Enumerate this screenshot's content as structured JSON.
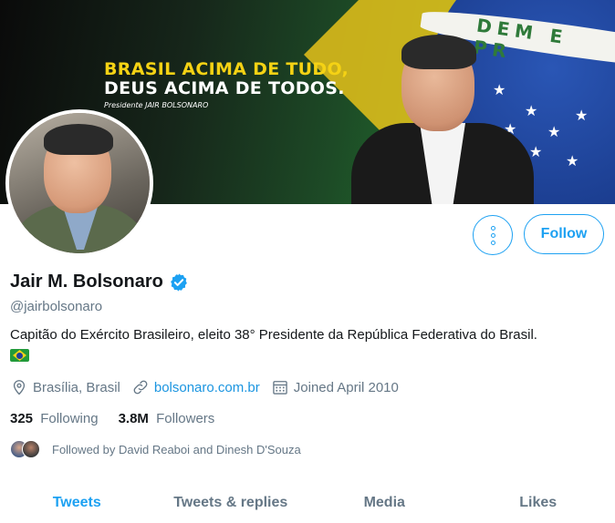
{
  "banner": {
    "slogan_line1": "BRASIL ACIMA DE TUDO,",
    "slogan_line2": "DEUS ACIMA DE TODOS.",
    "slogan_caption": "Presidente JAIR BOLSONARO",
    "flag_motto": "DEM E PR"
  },
  "actions": {
    "more_icon": "more-vertical-icon",
    "follow_label": "Follow",
    "accent_color": "#1da1f2"
  },
  "profile": {
    "name": "Jair M. Bolsonaro",
    "verified_icon": "verified-badge-icon",
    "handle": "@jairbolsonaro",
    "bio": "Capitão do Exército Brasileiro, eleito 38° Presidente da República Federativa do Brasil.",
    "bio_emoji": "brazil-flag-emoji",
    "location": "Brasília, Brasil",
    "website": "bolsonaro.com.br",
    "joined": "Joined April 2010"
  },
  "stats": {
    "following_count": "325",
    "following_label": "Following",
    "followers_count": "3.8M",
    "followers_label": "Followers"
  },
  "followed_by": {
    "text": "Followed by David Reaboi and Dinesh D'Souza"
  },
  "tabs": [
    {
      "label": "Tweets",
      "active": true
    },
    {
      "label": "Tweets & replies",
      "active": false
    },
    {
      "label": "Media",
      "active": false
    },
    {
      "label": "Likes",
      "active": false
    }
  ]
}
